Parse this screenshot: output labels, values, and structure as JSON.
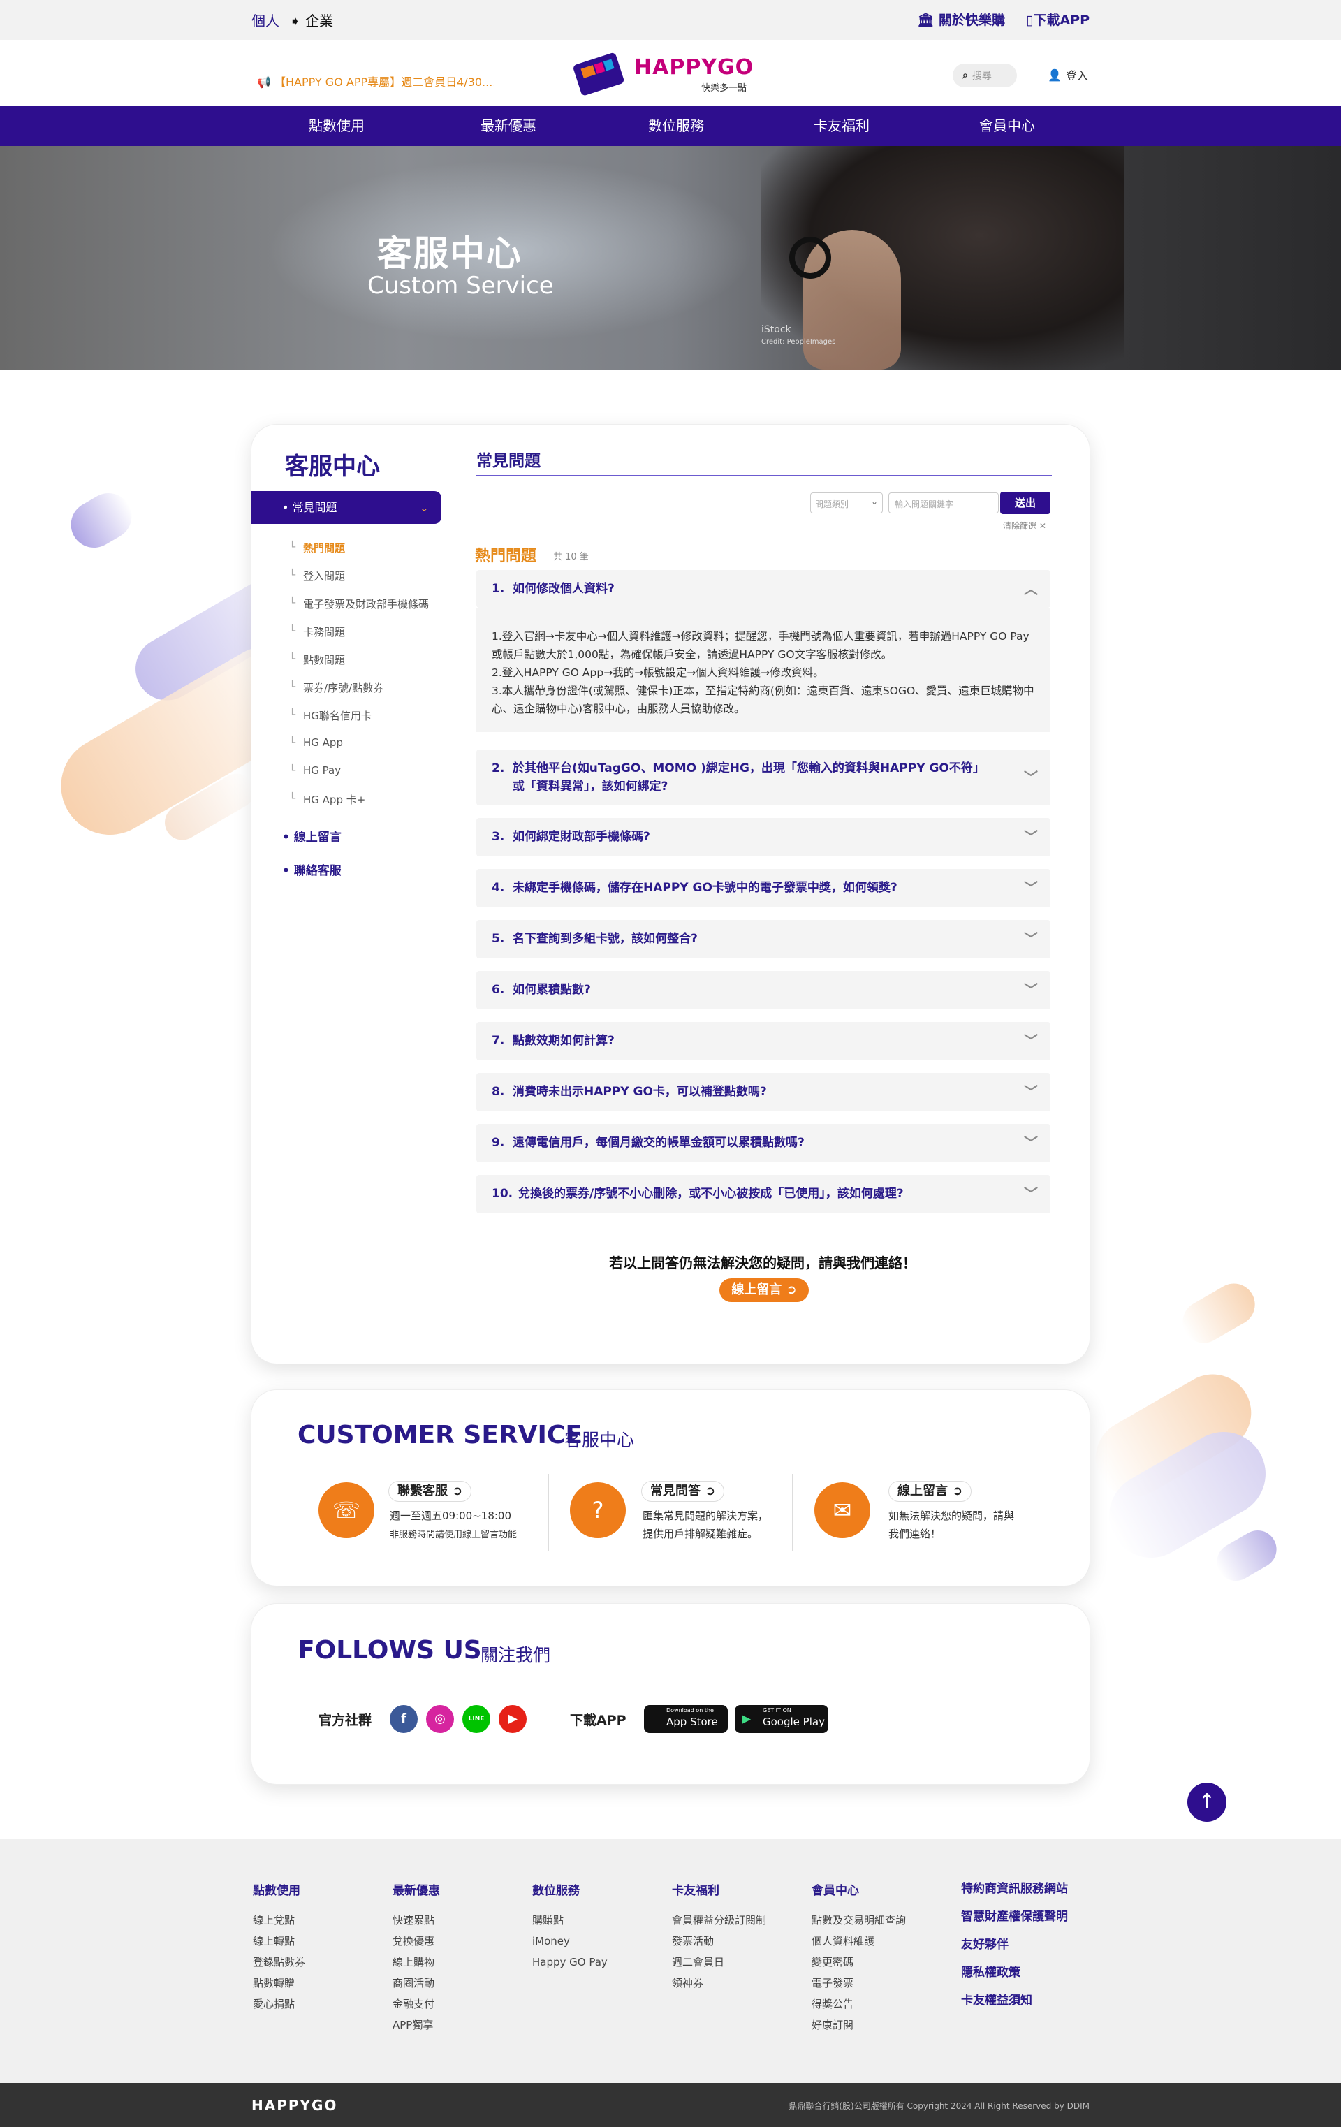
{
  "topbar": {
    "personal": "個人",
    "enterprise": "企業",
    "about": "關於快樂購",
    "download": "下載APP"
  },
  "header": {
    "marquee": "【HAPPY GO APP專屬】週二會員日4/30....",
    "logo_text": "HAPPYGO",
    "logo_sub": "快樂多一點",
    "search_placeholder": "搜尋",
    "login": "登入"
  },
  "nav": [
    "點數使用",
    "最新優惠",
    "數位服務",
    "卡友福利",
    "會員中心"
  ],
  "hero": {
    "title": "客服中心",
    "subtitle": "Custom Service",
    "credit": "iStock",
    "credit2": "Credit: PeopleImages"
  },
  "sidebar": {
    "title": "客服中心",
    "active": "常見問題",
    "subs": [
      "熱門問題",
      "登入問題",
      "電子發票及財政部手機條碼",
      "卡務問題",
      "點數問題",
      "票券/序號/點數券",
      "HG聯名信用卡",
      "HG App",
      "HG Pay",
      "HG App 卡+"
    ],
    "links": [
      "線上留言",
      "聯絡客服"
    ]
  },
  "faq": {
    "title": "常見問題",
    "select_placeholder": "問題類別",
    "keyword_placeholder": "輸入問題關鍵字",
    "send": "送出",
    "clear": "清除篩選",
    "hot": "熱門問題",
    "count": "共 10 筆",
    "q1": "如何修改個人資料?",
    "answer": [
      "1.登入官網→卡友中心→個人資料維護→修改資料；提醒您，手機門號為個人重要資訊，若申辦過HAPPY GO Pay或帳戶點數大於1,000點，為確保帳戶安全，請透過HAPPY GO文字客服核對修改。",
      "2.登入HAPPY GO App→我的→帳號設定→個人資料維護→修改資料。",
      "3.本人攜帶身份證件(或駕照、健保卡)正本，至指定特約商(例如：遠東百貨、遠東SOGO、愛買、遠東巨城購物中心、遠企購物中心)客服中心，由服務人員協助修改。"
    ],
    "questions": [
      {
        "num": "2.",
        "text": "於其他平台(如uTagGO、MOMO )綁定HG，出現「您輸入的資料與HAPPY GO不符」或「資料異常」，該如何綁定?"
      },
      {
        "num": "3.",
        "text": "如何綁定財政部手機條碼?"
      },
      {
        "num": "4.",
        "text": "未綁定手機條碼，儲存在HAPPY GO卡號中的電子發票中獎，如何領獎?"
      },
      {
        "num": "5.",
        "text": "名下查詢到多組卡號，該如何整合?"
      },
      {
        "num": "6.",
        "text": "如何累積點數?"
      },
      {
        "num": "7.",
        "text": "點數效期如何計算?"
      },
      {
        "num": "8.",
        "text": "消費時未出示HAPPY GO卡，可以補登點數嗎?"
      },
      {
        "num": "9.",
        "text": "遠傳電信用戶，每個月繳交的帳單金額可以累積點數嗎?"
      },
      {
        "num": "10.",
        "text": "兌換後的票券/序號不小心刪除，或不小心被按成「已使用」，該如何處理?"
      }
    ],
    "bottom": "若以上問答仍無法解決您的疑問，請與我們連絡！",
    "online_btn": "線上留言"
  },
  "cs": {
    "title": "CUSTOMER SERVICE",
    "sub": "客服中心",
    "items": [
      {
        "btn": "聯繫客服",
        "d1": "週一至週五09:00~18:00",
        "d2": "非服務時間請使用線上留言功能"
      },
      {
        "btn": "常見問答",
        "d1": "匯集常見問題的解決方案，",
        "d2": "提供用戶排解疑難雜症。"
      },
      {
        "btn": "線上留言",
        "d1": "如無法解決您的疑問，請與",
        "d2": "我們連絡！"
      }
    ]
  },
  "follow": {
    "title": "FOLLOWS US",
    "sub": "關注我們",
    "official": "官方社群",
    "download": "下載APP",
    "appstore": "App Store",
    "appstore_small": "Download on the",
    "gplay": "Google Play",
    "gplay_small": "GET IT ON",
    "line": "LINE"
  },
  "footer": {
    "cols": [
      {
        "h": "點數使用",
        "items": [
          "線上兌點",
          "線上轉點",
          "登錄點數券",
          "點數轉贈",
          "愛心捐點"
        ]
      },
      {
        "h": "最新優惠",
        "items": [
          "快速累點",
          "兌換優惠",
          "線上購物",
          "商圈活動",
          "金融支付",
          "APP獨享"
        ]
      },
      {
        "h": "數位服務",
        "items": [
          "購賺點",
          "iMoney",
          "Happy GO Pay"
        ]
      },
      {
        "h": "卡友福利",
        "items": [
          "會員權益分級訂閱制",
          "發票活動",
          "週二會員日",
          "領神券"
        ]
      },
      {
        "h": "會員中心",
        "items": [
          "點數及交易明細查詢",
          "個人資料維護",
          "變更密碼",
          "電子發票",
          "得獎公告",
          "好康訂閱"
        ]
      }
    ],
    "right": [
      "特約商資訊服務網站",
      "智慧財產權保護聲明",
      "友好夥伴",
      "隱私權政策",
      "卡友權益須知"
    ],
    "logo": "HAPPYGO",
    "copyright": "鼎鼎聯合行銷(股)公司版權所有 Copyright 2024 All Right Reserved by DDIM"
  },
  "colors": {
    "brand": "#2e0e8e",
    "accent": "#ef7d1a"
  }
}
